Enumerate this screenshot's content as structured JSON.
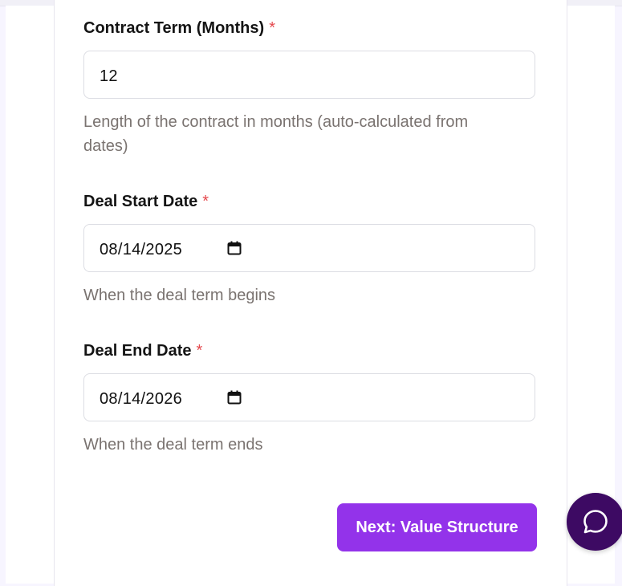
{
  "form": {
    "contract_term": {
      "label": "Contract Term (Months)",
      "required_mark": "*",
      "value": "12",
      "help": "Length of the contract in months (auto-calculated from dates)"
    },
    "deal_start": {
      "label": "Deal Start Date",
      "required_mark": "*",
      "value": "08/14/2025",
      "help": "When the deal term begins"
    },
    "deal_end": {
      "label": "Deal End Date",
      "required_mark": "*",
      "value": "08/14/2026",
      "help": "When the deal term ends"
    }
  },
  "actions": {
    "next_label": "Next: Value Structure"
  },
  "icons": {
    "calendar": "calendar-icon",
    "chat": "chat-bubble-icon"
  },
  "colors": {
    "primary_button": "#9333ea",
    "chat_fab": "#3d0a63",
    "required": "#e5484d",
    "help_text": "#7a7370"
  }
}
